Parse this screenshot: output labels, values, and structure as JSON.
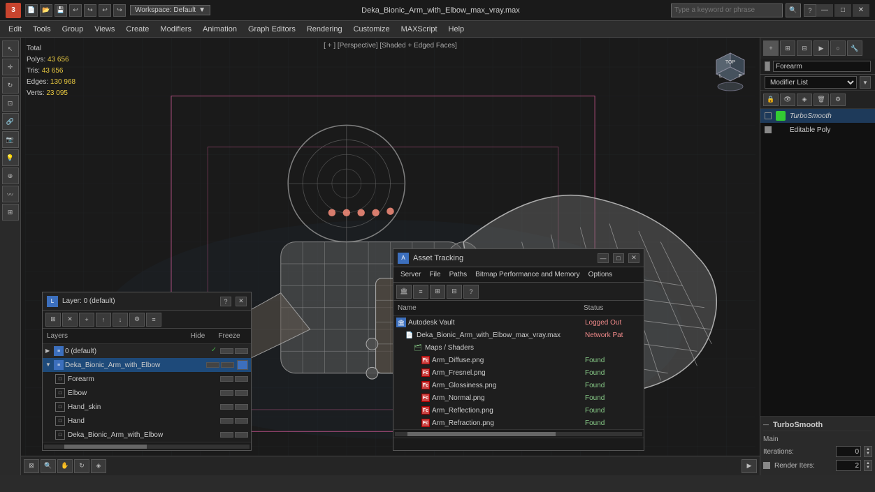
{
  "titlebar": {
    "logo": "3",
    "workspace_label": "Workspace: Default",
    "filename": "Deka_Bionic_Arm_with_Elbow_max_vray.max",
    "search_placeholder": "Type a keyword or phrase",
    "min_btn": "—",
    "max_btn": "□",
    "close_btn": "✕"
  },
  "menubar": {
    "items": [
      "Edit",
      "Tools",
      "Group",
      "Views",
      "Create",
      "Modifiers",
      "Animation",
      "Graph Editors",
      "Rendering",
      "Customize",
      "MAXScript",
      "Help"
    ]
  },
  "viewport": {
    "label": "[ + ] [Perspective] [Shaded + Edged Faces]",
    "stats": {
      "polys_label": "Polys:",
      "polys_value": "43 656",
      "tris_label": "Tris:",
      "tris_value": "43 656",
      "edges_label": "Edges:",
      "edges_value": "130 968",
      "verts_label": "Verts:",
      "verts_value": "23 095",
      "total_label": "Total"
    }
  },
  "right_panel": {
    "object_name": "Forearm",
    "modifier_list_label": "Modifier List",
    "modifiers": [
      {
        "name": "TurboSmooth",
        "active": true,
        "checked": false
      },
      {
        "name": "Editable Poly",
        "active": false,
        "checked": true
      }
    ],
    "turbosmooth": {
      "title": "TurboSmooth",
      "main_label": "Main",
      "iterations_label": "Iterations:",
      "iterations_value": "0",
      "render_iters_label": "Render Iters:",
      "render_iters_value": "2"
    }
  },
  "layer_panel": {
    "title": "Layer: 0 (default)",
    "layers_col": "Layers",
    "hide_col": "Hide",
    "freeze_col": "Freeze",
    "layers": [
      {
        "name": "0 (default)",
        "indent": 0,
        "checked": true,
        "type": "root"
      },
      {
        "name": "Deka_Bionic_Arm_with_Elbow",
        "indent": 0,
        "checked": false,
        "type": "main",
        "selected": true
      },
      {
        "name": "Forearm",
        "indent": 1,
        "checked": false,
        "type": "child"
      },
      {
        "name": "Elbow",
        "indent": 1,
        "checked": false,
        "type": "child"
      },
      {
        "name": "Hand_skin",
        "indent": 1,
        "checked": false,
        "type": "child"
      },
      {
        "name": "Hand",
        "indent": 1,
        "checked": false,
        "type": "child"
      },
      {
        "name": "Deka_Bionic_Arm_with_Elbow",
        "indent": 1,
        "checked": false,
        "type": "child"
      }
    ]
  },
  "asset_panel": {
    "title": "Asset Tracking",
    "menu_items": [
      "Server",
      "File",
      "Paths",
      "Bitmap Performance and Memory",
      "Options"
    ],
    "cols": {
      "name": "Name",
      "status": "Status"
    },
    "toolbar_btns": [
      "▤",
      "≡",
      "⊞",
      "⊟",
      "⊠"
    ],
    "assets": [
      {
        "name": "Autodesk Vault",
        "status": "Logged Out",
        "status_class": "status-loggedout",
        "type": "vault",
        "indent": 0
      },
      {
        "name": "Deka_Bionic_Arm_with_Elbow_max_vray.max",
        "status": "Network Pat",
        "status_class": "status-loggedout",
        "type": "file",
        "indent": 1
      },
      {
        "name": "Maps / Shaders",
        "status": "",
        "status_class": "",
        "type": "maps",
        "indent": 2
      },
      {
        "name": "Arm_Diffuse.png",
        "status": "Found",
        "status_class": "status-found",
        "type": "texture",
        "indent": 3
      },
      {
        "name": "Arm_Fresnel.png",
        "status": "Found",
        "status_class": "status-found",
        "type": "texture",
        "indent": 3
      },
      {
        "name": "Arm_Glossiness.png",
        "status": "Found",
        "status_class": "status-found",
        "type": "texture",
        "indent": 3
      },
      {
        "name": "Arm_Normal.png",
        "status": "Found",
        "status_class": "status-found",
        "type": "texture",
        "indent": 3
      },
      {
        "name": "Arm_Reflection.png",
        "status": "Found",
        "status_class": "status-found",
        "type": "texture",
        "indent": 3
      },
      {
        "name": "Arm_Refraction.png",
        "status": "Found",
        "status_class": "status-found",
        "type": "texture",
        "indent": 3
      }
    ]
  }
}
